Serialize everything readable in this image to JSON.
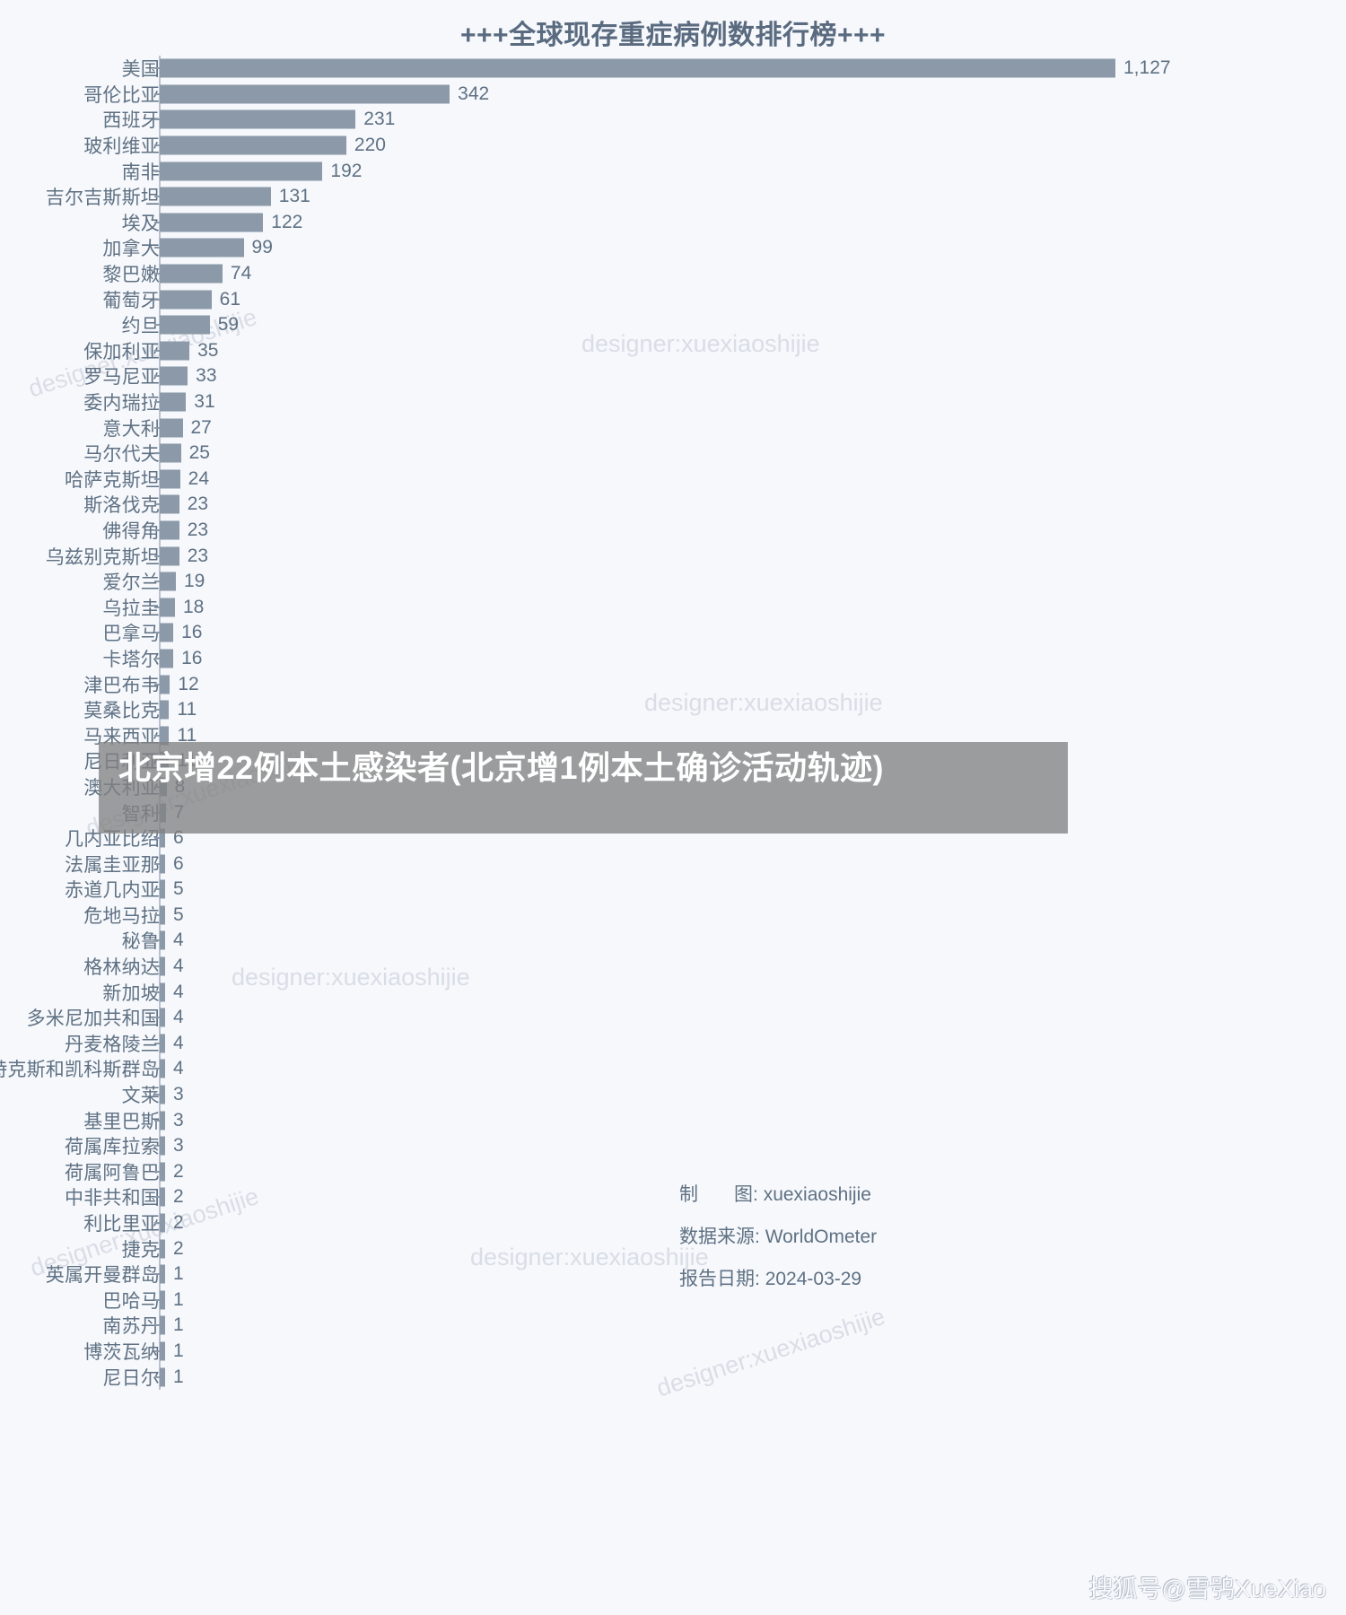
{
  "chart_data": {
    "type": "bar",
    "orientation": "horizontal",
    "title": "+++全球现存重症病例数排行榜+++",
    "xlabel": "",
    "ylabel": "",
    "grid": false,
    "legend": null,
    "xlim": [
      0,
      1127
    ],
    "categories": [
      "美国",
      "哥伦比亚",
      "西班牙",
      "玻利维亚",
      "南非",
      "吉尔吉斯斯坦",
      "埃及",
      "加拿大",
      "黎巴嫩",
      "葡萄牙",
      "约旦",
      "保加利亚",
      "罗马尼亚",
      "委内瑞拉",
      "意大利",
      "马尔代夫",
      "哈萨克斯坦",
      "斯洛伐克",
      "佛得角",
      "乌兹别克斯坦",
      "爱尔兰",
      "乌拉圭",
      "巴拿马",
      "卡塔尔",
      "津巴布韦",
      "莫桑比克",
      "马来西亚",
      "尼日利亚",
      "澳大利亚",
      "智利",
      "几内亚比绍",
      "法属圭亚那",
      "赤道几内亚",
      "危地马拉",
      "秘鲁",
      "格林纳达",
      "新加坡",
      "多米尼加共和国",
      "丹麦格陵兰",
      "特克斯和凯科斯群岛",
      "文莱",
      "基里巴斯",
      "荷属库拉索",
      "荷属阿鲁巴",
      "中非共和国",
      "利比里亚",
      "捷克",
      "英属开曼群岛",
      "巴哈马",
      "南苏丹",
      "博茨瓦纳",
      "尼日尔"
    ],
    "values": [
      1127,
      342,
      231,
      220,
      192,
      131,
      122,
      99,
      74,
      61,
      59,
      35,
      33,
      31,
      27,
      25,
      24,
      23,
      23,
      23,
      19,
      18,
      16,
      16,
      12,
      11,
      11,
      11,
      8,
      7,
      6,
      6,
      5,
      5,
      4,
      4,
      4,
      4,
      4,
      4,
      3,
      3,
      3,
      2,
      2,
      2,
      2,
      1,
      1,
      1,
      1,
      1
    ],
    "value_labels": [
      "1,127",
      "342",
      "231",
      "220",
      "192",
      "131",
      "122",
      "99",
      "74",
      "61",
      "59",
      "35",
      "33",
      "31",
      "27",
      "25",
      "24",
      "23",
      "23",
      "23",
      "19",
      "18",
      "16",
      "16",
      "12",
      "11",
      "11",
      "11",
      "8",
      "7",
      "6",
      "6",
      "5",
      "5",
      "4",
      "4",
      "4",
      "4",
      "4",
      "4",
      "3",
      "3",
      "3",
      "2",
      "2",
      "2",
      "2",
      "1",
      "1",
      "1",
      "1",
      "1"
    ],
    "bar_color": "#8b99a8",
    "label_color": "#5f7183",
    "background": "#f6f8fc"
  },
  "credits": {
    "designer_key": "制",
    "designer_key2": "图:",
    "designer_value": "xuexiaoshijie",
    "source_key": "数据来源:",
    "source_value": "WorldOmeter",
    "date_key": "报告日期:",
    "date_value": "2024-03-29"
  },
  "overlay": {
    "headline": "北京增22例本土感染者(北京增1例本土确诊活动轨迹)"
  },
  "watermarks": {
    "designer_text": "designer:xuexiaoshijie",
    "site": "搜狐号@雪鸮XueXiao"
  },
  "colors": {
    "bar": "#8b99a8",
    "text": "#5f7183",
    "background": "#f6f8fc",
    "watermark": "#d9dde6",
    "overlay": "#828282"
  }
}
